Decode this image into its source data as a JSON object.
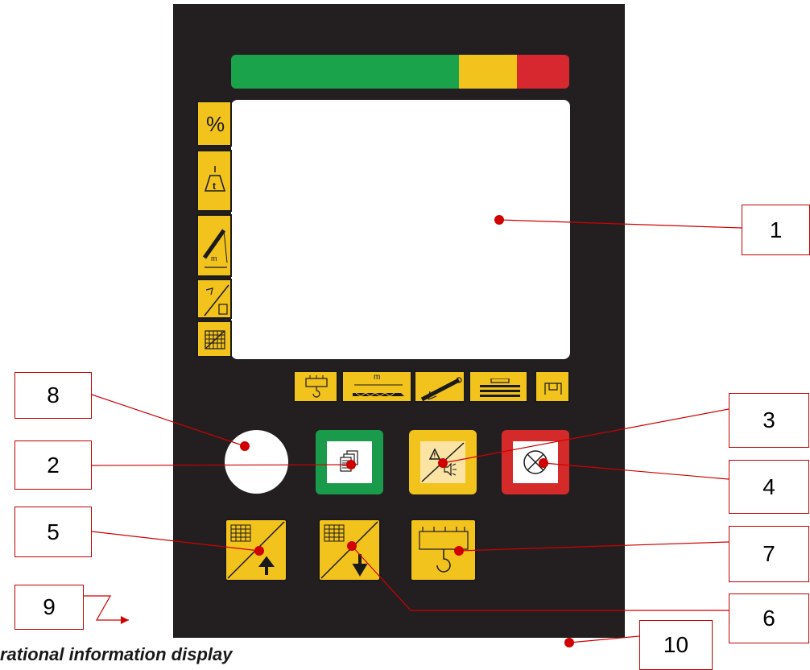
{
  "colors": {
    "panel": "#231f20",
    "button_yellow": "#f2c21d",
    "bar_green": "#1aa34a",
    "bar_yellow": "#f2c21d",
    "bar_red": "#d7282f",
    "button_green": "#1a9b4b",
    "button_red": "#d52a2a",
    "callout_line": "#d00000"
  },
  "load_bar": {
    "segments": [
      "green",
      "yellow",
      "red"
    ]
  },
  "side_buttons": [
    {
      "id": "percent",
      "label": "%",
      "icon": "percent-icon"
    },
    {
      "id": "load",
      "label": "t",
      "icon": "load-weight-icon"
    },
    {
      "id": "boom",
      "label": "m",
      "icon": "boom-radius-icon"
    },
    {
      "id": "jib",
      "label": "",
      "icon": "jib-angle-icon"
    },
    {
      "id": "grid",
      "label": "",
      "icon": "grid-icon"
    }
  ],
  "bottom_buttons": [
    {
      "id": "hook",
      "label": "",
      "icon": "hook-icon"
    },
    {
      "id": "boom-length",
      "label": "m",
      "icon": "boom-length-icon"
    },
    {
      "id": "jib",
      "label": "",
      "icon": "jib-icon"
    },
    {
      "id": "counterweight",
      "label": "",
      "icon": "counterweight-icon"
    },
    {
      "id": "outrigger",
      "label": "",
      "icon": "outrigger-icon"
    }
  ],
  "keys": [
    {
      "id": "pages",
      "icon": "pages-icon"
    },
    {
      "id": "alarm-mute",
      "icon": "alarm-mute-icon"
    },
    {
      "id": "stop",
      "icon": "stop-icon"
    },
    {
      "id": "grid-up",
      "icon": "grid-up-icon"
    },
    {
      "id": "grid-down",
      "icon": "grid-down-icon"
    },
    {
      "id": "hook-select",
      "icon": "hook-select-icon"
    }
  ],
  "callouts": [
    "1",
    "2",
    "3",
    "4",
    "5",
    "6",
    "7",
    "8",
    "9",
    "10"
  ],
  "caption": "rational information display"
}
